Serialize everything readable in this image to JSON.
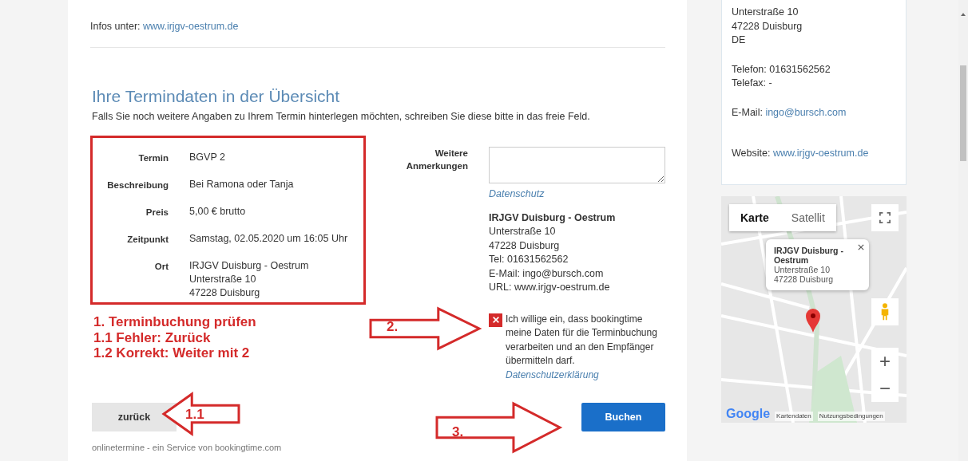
{
  "info_line": {
    "label": "Infos unter:",
    "link": "www.irjgv-oestrum.de"
  },
  "heading": "Ihre Termindaten in der Übersicht",
  "intro": "Falls Sie noch weitere Angaben zu Ihrem Termin hinterlegen möchten, schreiben Sie diese bitte in das freie Feld.",
  "details": [
    {
      "label": "Termin",
      "lines": [
        "BGVP 2"
      ]
    },
    {
      "label": "Beschreibung",
      "lines": [
        "Bei Ramona oder Tanja"
      ]
    },
    {
      "label": "Preis",
      "lines": [
        "5,00 € brutto"
      ]
    },
    {
      "label": "Zeitpunkt",
      "lines": [
        "Samstag, 02.05.2020 um 16:05 Uhr"
      ]
    },
    {
      "label": "Ort",
      "lines": [
        "IRJGV Duisburg - Oestrum",
        "Unterstraße 10",
        "47228 Duisburg"
      ]
    }
  ],
  "notes_field": {
    "label": "Weitere Anmerkungen"
  },
  "privacy_link": "Datenschutz",
  "provider": {
    "name": "IRJGV Duisburg - Oestrum",
    "lines": [
      "Unterstraße 10",
      "47228 Duisburg",
      "Tel: 01631562562",
      "E-Mail: ingo@bursch.com",
      "URL: www.irjgv-oestrum.de"
    ]
  },
  "consent": {
    "checked": true,
    "text": "Ich willige ein, dass bookingtime meine Daten für die Terminbuchung verarbeiten und an den Empfänger übermitteln darf.",
    "link": "Datenschutzerklärung"
  },
  "buttons": {
    "back": "zurück",
    "book": "Buchen"
  },
  "footer": "onlinetermine - ein Service von bookingtime.com",
  "annotations": {
    "steps": [
      "1. Terminbuchung prüfen",
      "1.1 Fehler: Zurück",
      "1.2 Korrekt: Weiter mit 2"
    ],
    "arrows": [
      {
        "label": "2.",
        "kind": "right"
      },
      {
        "label": "1.1",
        "kind": "left"
      },
      {
        "label": "3.",
        "kind": "right"
      }
    ]
  },
  "contact_card": {
    "lines": [
      "Unterstraße 10",
      "47228 Duisburg",
      "DE"
    ],
    "phone": "Telefon: 01631562562",
    "fax": "Telefax: -",
    "email_label": "E-Mail:",
    "email": "ingo@bursch.com",
    "website_label": "Website:",
    "website": "www.irjgv-oestrum.de"
  },
  "map": {
    "tabs": [
      {
        "label": "Karte",
        "selected": true
      },
      {
        "label": "Satellit",
        "selected": false
      }
    ],
    "popup": {
      "title": "IRJGV Duisburg - Oestrum",
      "lines": [
        "Unterstraße 10",
        "47228 Duisburg"
      ]
    },
    "zoom_in": "+",
    "zoom_out": "−",
    "logo": "Google",
    "attribution": "Kartendaten",
    "terms": "Nutzungsbedingungen"
  }
}
